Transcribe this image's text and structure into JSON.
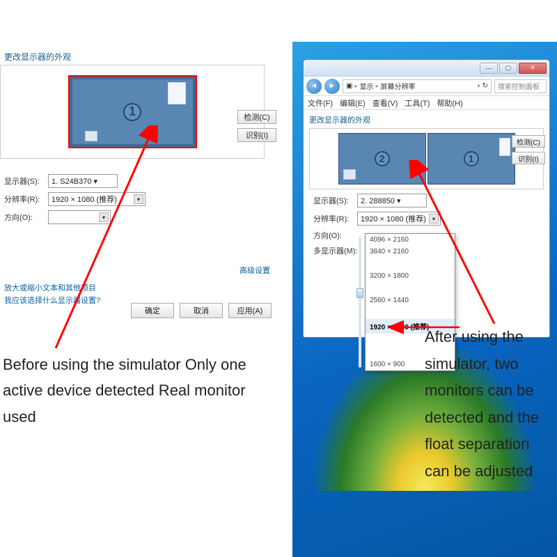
{
  "panel_before": {
    "title": "更改显示器的外观",
    "monitor_id": "1",
    "fields": {
      "display_label": "显示器(S):",
      "display_value": "1. S24B370 ▾",
      "resolution_label": "分辨率(R):",
      "resolution_value": "1920 × 1080 (推荐)",
      "orientation_label": "方向(O):",
      "orientation_value": ""
    },
    "side_buttons": {
      "detect": "检测(C)",
      "identify": "识别(I)"
    },
    "right_link": "高级设置",
    "link1": "放大或缩小文本和其他项目",
    "link2": "我应该选择什么显示器设置?",
    "ok": "确定",
    "cancel": "取消",
    "apply": "应用(A)"
  },
  "panel_after": {
    "window_controls": {
      "min": "—",
      "max": "▢",
      "close": "✕"
    },
    "nav": {
      "back": "◄",
      "fwd": "►",
      "seg1": "显示",
      "seg2": "屏幕分辨率",
      "refresh": "↻",
      "search_ph": "搜索控制面板"
    },
    "menu": {
      "file": "文件(F)",
      "edit": "编辑(E)",
      "view": "查看(V)",
      "tools": "工具(T)",
      "help": "帮助(H)"
    },
    "heading": "更改显示器的外观",
    "monitor_a": "2",
    "monitor_b": "1",
    "side_buttons": {
      "detect": "检测(C)",
      "identify": "识别(I)"
    },
    "fields": {
      "display_label": "显示器(S):",
      "display_value": "2. 288850 ▾",
      "resolution_label": "分辨率(R):",
      "resolution_value": "1920 × 1080 (推荐)",
      "orientation_label": "方向(O):",
      "multi_label": "多显示器(M):"
    },
    "resolution_list": [
      "4096 × 2160",
      "3840 × 2160",
      "3200 × 1800",
      "2560 × 1440",
      "1920 × 1080 (推荐)",
      "1600 × 900"
    ]
  },
  "captions": {
    "left": "Before using the simulator Only one active device detected Real monitor used",
    "right": "After using the simulator, two monitors can be detected and the float separation can be adjusted"
  }
}
